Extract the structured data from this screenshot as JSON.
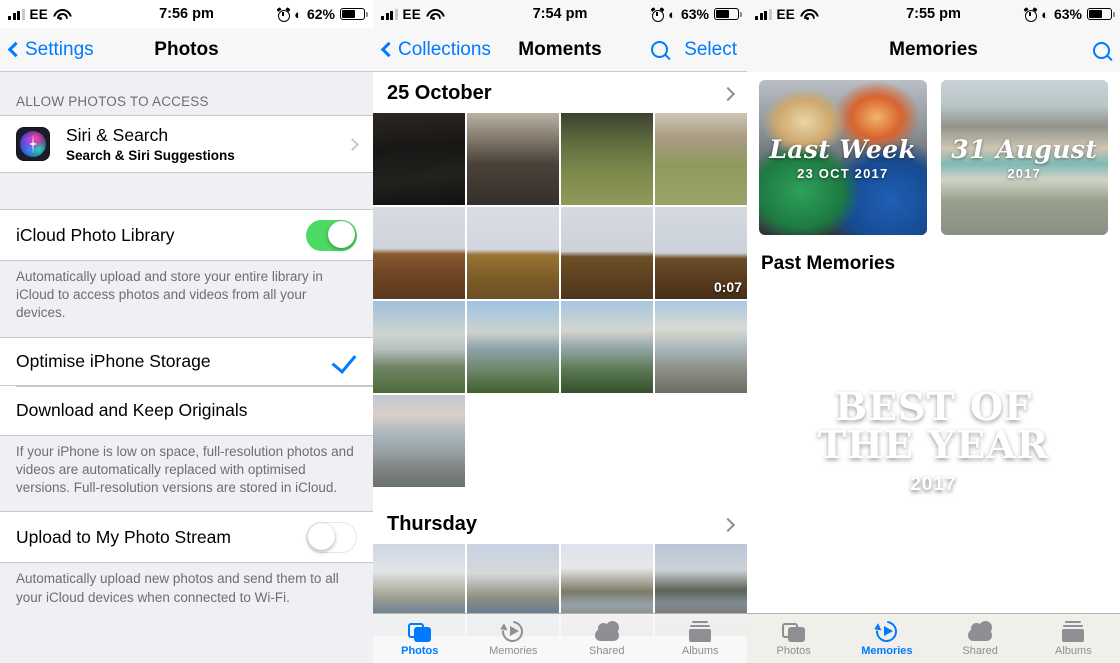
{
  "screens": {
    "settings": {
      "status": {
        "carrier": "EE",
        "time": "7:56 pm",
        "battery_pct": "62%",
        "wifi_icon": "wifi-icon",
        "alarm_icon": "alarm-icon",
        "bluetooth_icon": "bluetooth-icon",
        "battery_icon": "battery-icon"
      },
      "nav": {
        "back_label": "Settings",
        "title": "Photos"
      },
      "group_header": "ALLOW PHOTOS TO ACCESS",
      "siri_row": {
        "title": "Siri & Search",
        "subtitle": "Search & Siri Suggestions",
        "icon": "siri-icon",
        "chevron": "chevron-right-icon"
      },
      "icloud_row": {
        "label": "iCloud Photo Library",
        "toggle_state": "on"
      },
      "icloud_footer": "Automatically upload and store your entire library in iCloud to access photos and videos from all your devices.",
      "storage_options": [
        {
          "label": "Optimise iPhone Storage",
          "selected": true
        },
        {
          "label": "Download and Keep Originals",
          "selected": false
        }
      ],
      "storage_footer": "If your iPhone is low on space, full-resolution photos and videos are automatically replaced with optimised versions. Full-resolution versions are stored in iCloud.",
      "photostream_row": {
        "label": "Upload to My Photo Stream",
        "toggle_state": "off"
      },
      "photostream_footer": "Automatically upload new photos and send them to all your iCloud devices when connected to Wi-Fi."
    },
    "moments": {
      "status": {
        "carrier": "EE",
        "time": "7:54 pm",
        "battery_pct": "63%"
      },
      "nav": {
        "back_label": "Collections",
        "title": "Moments",
        "search_icon": "search-icon",
        "select_label": "Select"
      },
      "sections": [
        {
          "date": "25 October",
          "chevron": "chevron-right-icon",
          "photos": [
            {
              "art": "p-rock1",
              "duration": ""
            },
            {
              "art": "p-rock2",
              "duration": ""
            },
            {
              "art": "p-grass1",
              "duration": ""
            },
            {
              "art": "p-grass2",
              "duration": ""
            },
            {
              "art": "p-rb1",
              "duration": ""
            },
            {
              "art": "p-rb2",
              "duration": ""
            },
            {
              "art": "p-rb3",
              "duration": ""
            },
            {
              "art": "p-rb4",
              "duration": "0:07"
            },
            {
              "art": "p-sea1",
              "duration": ""
            },
            {
              "art": "p-sea2",
              "duration": ""
            },
            {
              "art": "p-sea3",
              "duration": ""
            },
            {
              "art": "p-sea4",
              "duration": ""
            },
            {
              "art": "p-beach",
              "duration": ""
            }
          ]
        },
        {
          "date": "Thursday",
          "chevron": "chevron-right-icon",
          "photos": [
            {
              "art": "p-loch1",
              "duration": ""
            },
            {
              "art": "p-loch2",
              "duration": ""
            },
            {
              "art": "p-loch3",
              "duration": ""
            },
            {
              "art": "p-loch4",
              "duration": ""
            }
          ]
        }
      ],
      "tabs": [
        {
          "label": "Photos",
          "icon": "photos-icon",
          "active": true
        },
        {
          "label": "Memories",
          "icon": "memories-icon",
          "active": false
        },
        {
          "label": "Shared",
          "icon": "shared-cloud-icon",
          "active": false
        },
        {
          "label": "Albums",
          "icon": "albums-icon",
          "active": false
        }
      ]
    },
    "memories": {
      "status": {
        "carrier": "EE",
        "time": "7:55 pm",
        "battery_pct": "63%"
      },
      "nav": {
        "title": "Memories",
        "search_icon": "search-icon"
      },
      "top_cards": [
        {
          "title": "Last Week",
          "subtitle": "23 OCT 2017",
          "art": "art-selfie"
        },
        {
          "title": "31 August",
          "subtitle": "2017",
          "art": "art-rocks"
        }
      ],
      "section_title": "Past Memories",
      "big_card": {
        "title_line1": "BEST OF",
        "title_line2": "THE YEAR",
        "subtitle": "2017",
        "art": "art-hiker"
      },
      "tabs": [
        {
          "label": "Photos",
          "icon": "photos-icon",
          "active": false
        },
        {
          "label": "Memories",
          "icon": "memories-icon",
          "active": true
        },
        {
          "label": "Shared",
          "icon": "shared-cloud-icon",
          "active": false
        },
        {
          "label": "Albums",
          "icon": "albums-icon",
          "active": false
        }
      ]
    }
  },
  "colors": {
    "accent": "#007aff",
    "toggle_on": "#4cd964",
    "group_bg": "#efeff4",
    "secondary_text": "#6d6d72"
  }
}
